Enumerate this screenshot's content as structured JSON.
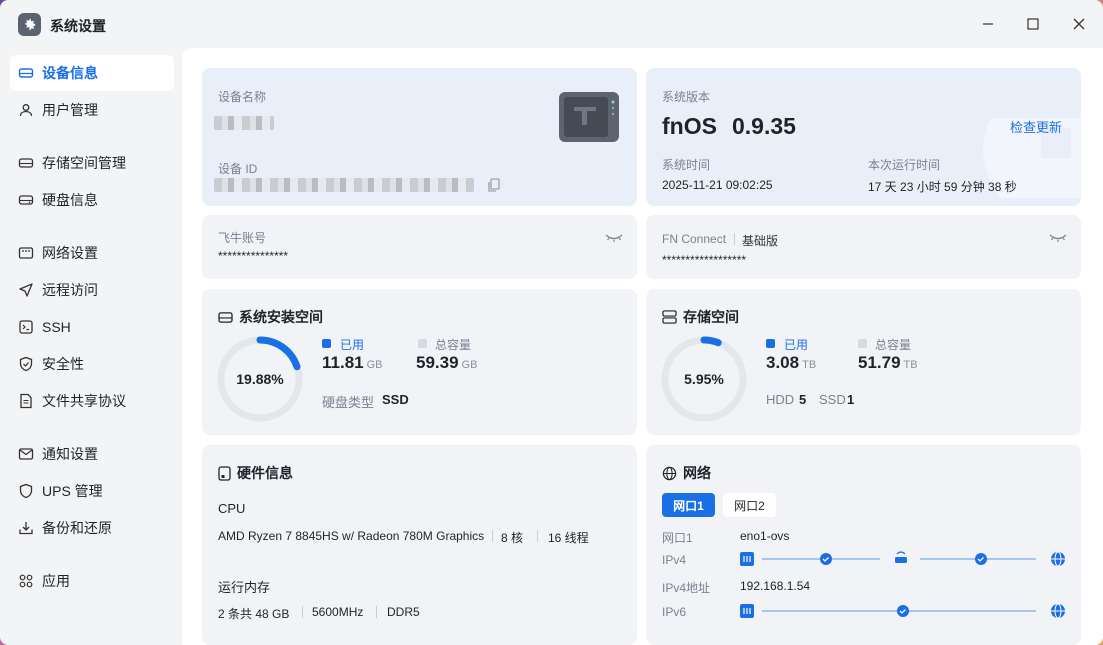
{
  "window": {
    "title": "系统设置"
  },
  "sidebar": {
    "items": [
      {
        "label": "设备信息",
        "icon": "device-icon"
      },
      {
        "label": "用户管理",
        "icon": "user-icon"
      },
      {
        "label": "存储空间管理",
        "icon": "storage-icon"
      },
      {
        "label": "硬盘信息",
        "icon": "disk-icon"
      },
      {
        "label": "网络设置",
        "icon": "network-icon"
      },
      {
        "label": "远程访问",
        "icon": "send-icon"
      },
      {
        "label": "SSH",
        "icon": "terminal-icon"
      },
      {
        "label": "安全性",
        "icon": "shield-icon"
      },
      {
        "label": "文件共享协议",
        "icon": "file-icon"
      },
      {
        "label": "通知设置",
        "icon": "mail-icon"
      },
      {
        "label": "UPS 管理",
        "icon": "ups-shield-icon"
      },
      {
        "label": "备份和还原",
        "icon": "backup-icon"
      },
      {
        "label": "应用",
        "icon": "apps-icon"
      }
    ]
  },
  "device": {
    "name_label": "设备名称",
    "id_label": "设备 ID"
  },
  "system": {
    "version_label": "系统版本",
    "os_name": "fnOS",
    "version": "0.9.35",
    "check_update": "检查更新",
    "time_label": "系统时间",
    "time_value": "2025-11-21 09:02:25",
    "uptime_label": "本次运行时间",
    "uptime_value": "17 天 23 小时 59 分钟 38 秒"
  },
  "account": {
    "label": "飞牛账号",
    "value": "***************"
  },
  "fnconnect": {
    "label": "FN Connect",
    "edition": "基础版",
    "value": "******************"
  },
  "sys_space": {
    "title": "系统安装空间",
    "percent": "19.88%",
    "percent_value": 19.88,
    "used_label": "已用",
    "used_value": "11.81",
    "used_unit": "GB",
    "total_label": "总容量",
    "total_value": "59.39",
    "total_unit": "GB",
    "disk_type_label": "硬盘类型",
    "disk_type": "SSD"
  },
  "storage": {
    "title": "存储空间",
    "percent": "5.95%",
    "percent_value": 5.95,
    "used_label": "已用",
    "used_value": "3.08",
    "used_unit": "TB",
    "total_label": "总容量",
    "total_value": "51.79",
    "total_unit": "TB",
    "hdd_label": "HDD",
    "hdd_count": "5",
    "ssd_label": "SSD",
    "ssd_count": "1"
  },
  "hardware": {
    "title": "硬件信息",
    "cpu_label": "CPU",
    "cpu_model": "AMD Ryzen 7 8845HS w/ Radeon 780M Graphics",
    "cpu_cores": "8 核",
    "cpu_threads": "16 线程",
    "mem_label": "运行内存",
    "mem_count": "2 条共 48 GB",
    "mem_speed": "5600MHz",
    "mem_type": "DDR5"
  },
  "network": {
    "title": "网络",
    "tabs": [
      "网口1",
      "网口2"
    ],
    "port_label": "网口1",
    "port_value": "eno1-ovs",
    "ipv4_label": "IPv4",
    "ipv4_addr_label": "IPv4地址",
    "ipv4_addr": "192.168.1.54",
    "ipv6_label": "IPv6"
  },
  "colors": {
    "accent": "#1b6fe6",
    "ring_track": "#e3e6eb",
    "card": "#f1f3f6",
    "card_highlight": "#e9eff8"
  }
}
